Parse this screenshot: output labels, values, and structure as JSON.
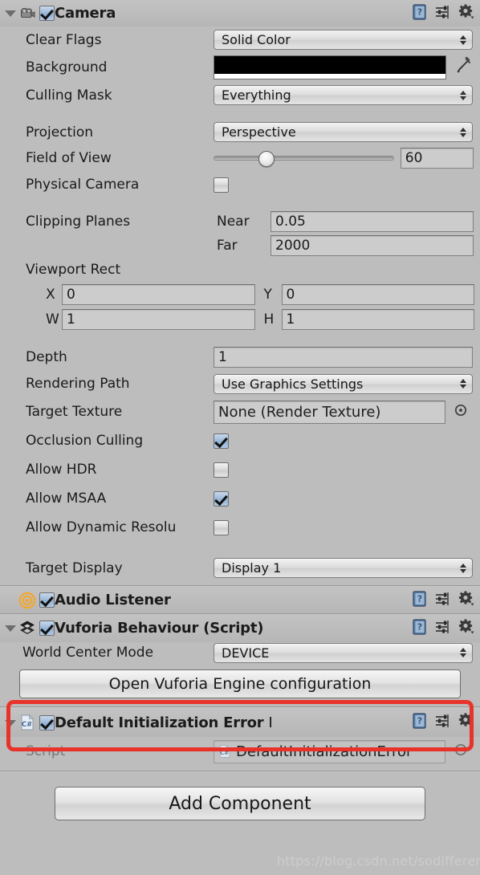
{
  "components": {
    "camera": {
      "title": "Camera",
      "icon": "camera-icon",
      "enabled": true,
      "expanded": true,
      "properties": {
        "clear_flags": {
          "label": "Clear Flags",
          "value": "Solid Color"
        },
        "background": {
          "label": "Background",
          "color": "#000000",
          "alpha_color": "#ffffff"
        },
        "culling_mask": {
          "label": "Culling Mask",
          "value": "Everything"
        },
        "projection": {
          "label": "Projection",
          "value": "Perspective"
        },
        "field_of_view": {
          "label": "Field of View",
          "value": "60",
          "slider_percent": 27
        },
        "physical_camera": {
          "label": "Physical Camera",
          "checked": false
        },
        "clipping_planes": {
          "label": "Clipping Planes",
          "near_label": "Near",
          "near_value": "0.05",
          "far_label": "Far",
          "far_value": "2000"
        },
        "viewport_rect": {
          "label": "Viewport Rect",
          "x_label": "X",
          "x_value": "0",
          "y_label": "Y",
          "y_value": "0",
          "w_label": "W",
          "w_value": "1",
          "h_label": "H",
          "h_value": "1"
        },
        "depth": {
          "label": "Depth",
          "value": "1"
        },
        "rendering_path": {
          "label": "Rendering Path",
          "value": "Use Graphics Settings"
        },
        "target_texture": {
          "label": "Target Texture",
          "value": "None (Render Texture)"
        },
        "occlusion_culling": {
          "label": "Occlusion Culling",
          "checked": true
        },
        "allow_hdr": {
          "label": "Allow HDR",
          "checked": false
        },
        "allow_msaa": {
          "label": "Allow MSAA",
          "checked": true
        },
        "allow_dynamic_resolution": {
          "label": "Allow Dynamic Resolu",
          "checked": false
        },
        "target_display": {
          "label": "Target Display",
          "value": "Display 1"
        }
      }
    },
    "audio_listener": {
      "title": "Audio Listener",
      "icon": "audio-listener-icon",
      "enabled": true,
      "expanded": false
    },
    "vuforia_behaviour": {
      "title": "Vuforia Behaviour (Script)",
      "icon": "vuforia-icon",
      "enabled": true,
      "expanded": true,
      "properties": {
        "world_center_mode": {
          "label": "World Center Mode",
          "value": "DEVICE"
        }
      },
      "open_config_button": "Open Vuforia Engine configuration"
    },
    "default_init_error_handler": {
      "title": "Default Initialization Error Hand",
      "icon": "csharp-script-icon",
      "enabled": true,
      "expanded": true,
      "properties": {
        "script": {
          "label": "Script",
          "value": "DefaultInitializationError"
        }
      }
    }
  },
  "footer": {
    "add_component_label": "Add Component"
  },
  "header_icons": {
    "help": "help-book-icon",
    "preset": "preset-sliders-icon",
    "settings": "gear-icon"
  },
  "watermark": "https://blog.csdn.net/sodifferent",
  "colors": {
    "panel_bg": "#bdbdbd",
    "highlight_red": "#e8332a",
    "checkbox_blue": "#9db9d9",
    "audio_icon_orange": "#f0a833"
  }
}
